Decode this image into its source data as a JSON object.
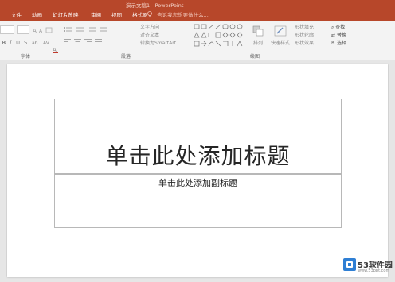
{
  "window": {
    "title": "演示文稿1 - PowerPoint"
  },
  "tabs": [
    {
      "label": "文件"
    },
    {
      "label": "动画"
    },
    {
      "label": "幻灯片放映"
    },
    {
      "label": "审阅"
    },
    {
      "label": "视图"
    },
    {
      "label": "格式刷"
    }
  ],
  "tell_me": {
    "text": "告诉我您想要做什么..."
  },
  "ribbon": {
    "groups": [
      {
        "label": "字体"
      },
      {
        "label": "段落"
      },
      {
        "label": "绘图"
      }
    ],
    "paragraph_controls": [
      {
        "label": "文字方向"
      },
      {
        "label": "对齐文本"
      },
      {
        "label": "转换为SmartArt"
      }
    ],
    "drawing": {
      "arrange_label": "排列",
      "quick_styles_label": "快速样式"
    },
    "shape_format": [
      {
        "label": "形状填充"
      },
      {
        "label": "形状轮廓"
      },
      {
        "label": "形状效果"
      }
    ],
    "editing": [
      {
        "label": "查找"
      },
      {
        "label": "替换"
      },
      {
        "label": "选择"
      }
    ]
  },
  "slide": {
    "title_placeholder": "单击此处添加标题",
    "subtitle_placeholder": "单击此处添加副标题"
  },
  "watermark": {
    "logo_text": "53软件园",
    "url": "www.53ppt.com",
    "accent_color": "#2f7fd4"
  },
  "colors": {
    "accent": "#b7472a",
    "ribbon_bg": "#f3f3f3",
    "workspace_bg": "#e6e6e6"
  }
}
